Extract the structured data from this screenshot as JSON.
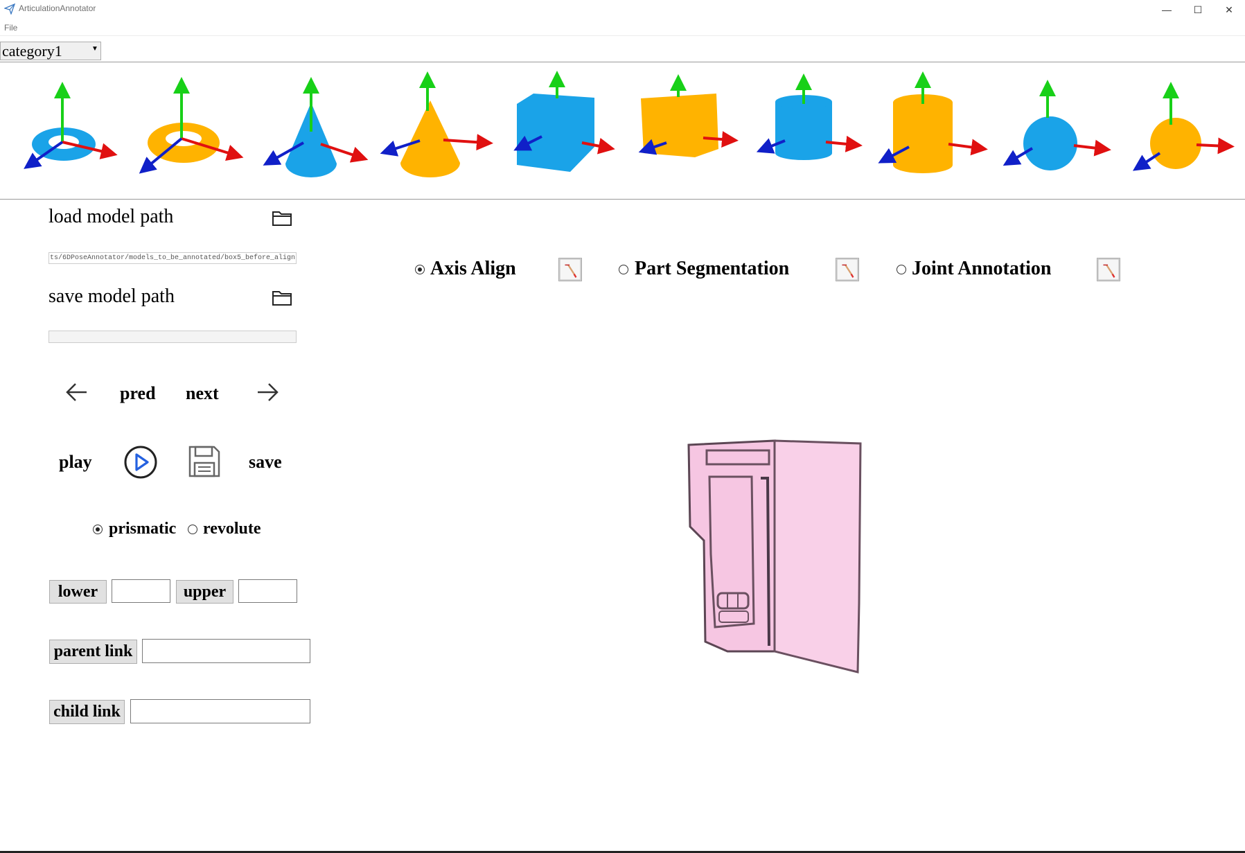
{
  "window": {
    "title": "ArticulationAnnotator",
    "minimize": "—",
    "maximize": "☐",
    "close": "✕"
  },
  "menu": {
    "file": "File"
  },
  "category": {
    "selected": "category1"
  },
  "shapes": [
    {
      "name": "torus-blue",
      "color": "#1aa3e8"
    },
    {
      "name": "torus-orange",
      "color": "#ffb300"
    },
    {
      "name": "cone-blue",
      "color": "#1aa3e8"
    },
    {
      "name": "cone-orange",
      "color": "#ffb300"
    },
    {
      "name": "cube-blue",
      "color": "#1aa3e8"
    },
    {
      "name": "cube-orange",
      "color": "#ffb300"
    },
    {
      "name": "cylinder-blue",
      "color": "#1aa3e8"
    },
    {
      "name": "cylinder-orange",
      "color": "#ffb300"
    },
    {
      "name": "sphere-blue",
      "color": "#1aa3e8"
    },
    {
      "name": "sphere-orange",
      "color": "#ffb300"
    }
  ],
  "left_panel": {
    "load_label": "load model path",
    "load_path": "ts/6DPoseAnnotator/models_to_be_annotated/box5_before_align",
    "save_label": "save model path",
    "save_path": "",
    "pred": "pred",
    "next": "next",
    "play": "play",
    "save": "save",
    "joint_types": {
      "prismatic": "prismatic",
      "revolute": "revolute",
      "selected": "prismatic"
    },
    "lower": "lower",
    "upper": "upper",
    "lower_value": "",
    "upper_value": "",
    "parent_link": "parent link",
    "child_link": "child link",
    "parent_value": "",
    "child_value": ""
  },
  "modes": {
    "axis_align": "Axis Align",
    "part_segmentation": "Part Segmentation",
    "joint_annotation": "Joint Annotation",
    "selected": "axis_align"
  },
  "colors": {
    "axis_x": "#e01010",
    "axis_y": "#18d018",
    "axis_z": "#1020c8",
    "model": "#f6c6e2"
  }
}
